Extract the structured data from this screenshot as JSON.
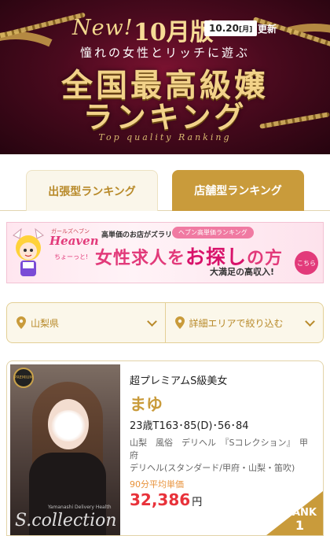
{
  "hero": {
    "new_label": "New!",
    "month_label": "10月版",
    "date": "10.20",
    "weekday": "[月]",
    "update_label": "更新",
    "tagline": "憧れの女性とリッチに遊ぶ",
    "title_line1": "全国最高級嬢",
    "title_line2": "ランキング",
    "subtitle": "Top quality Ranking"
  },
  "tabs": [
    {
      "label": "出張型ランキング",
      "active": true
    },
    {
      "label": "店舗型ランキング",
      "active": false
    }
  ],
  "ad": {
    "brand": "Heaven",
    "brand_small": "ガールズヘブン",
    "chotto": "ちょーっと!",
    "top_line": "高単価のお店がズラリ",
    "pill": "ヘブン高単価ランキング",
    "main_a": "女性求人を",
    "main_b": "お探し",
    "main_c": "の方",
    "sub": "大満足の高収入!",
    "cta": "こちら"
  },
  "filters": {
    "prefecture": "山梨県",
    "area": "詳細エリアで絞り込む"
  },
  "card": {
    "catch": "超プレミアムS級美女",
    "name": "まゆ",
    "spec": "23歳T163･85(D)･56･84",
    "shop_line1": "山梨　風俗　デリヘル　『Sコレクション』　甲府",
    "shop_line2": "デリヘル(スタンダード/甲府・山梨・笛吹)",
    "price_label": "90分平均単価",
    "price": "32,386",
    "price_unit": "円",
    "rank_label": "RANK",
    "rank_number": "1",
    "badge_text": "PREMIUM",
    "watermark": "S.collection",
    "watermark_small": "Yamanashi Delivery Health"
  },
  "colors": {
    "gold": "#c99b3b",
    "price_red": "#e8323a",
    "pink": "#e23a7a"
  }
}
